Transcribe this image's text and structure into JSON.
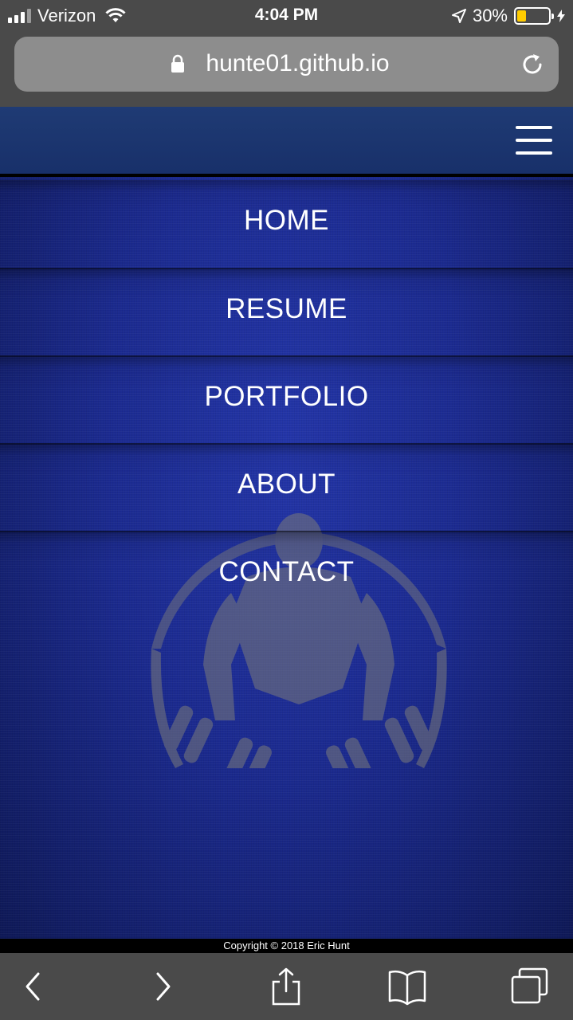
{
  "status_bar": {
    "carrier": "Verizon",
    "time": "4:04 PM",
    "battery_percent": "30%",
    "battery_level": 0.3,
    "battery_color": "#ffcc00"
  },
  "browser": {
    "url": "hunte01.github.io",
    "icons": [
      "lock-icon",
      "reload-icon",
      "back-icon",
      "forward-icon",
      "share-icon",
      "bookmarks-icon",
      "tabs-icon"
    ]
  },
  "site": {
    "menu": [
      {
        "label": "HOME"
      },
      {
        "label": "RESUME"
      },
      {
        "label": "PORTFOLIO"
      },
      {
        "label": "ABOUT"
      },
      {
        "label": "CONTACT"
      }
    ],
    "footer": "Copyright © 2018 Eric Hunt",
    "colors": {
      "header": "#1f3b74",
      "background": "#1b2a8f"
    }
  }
}
